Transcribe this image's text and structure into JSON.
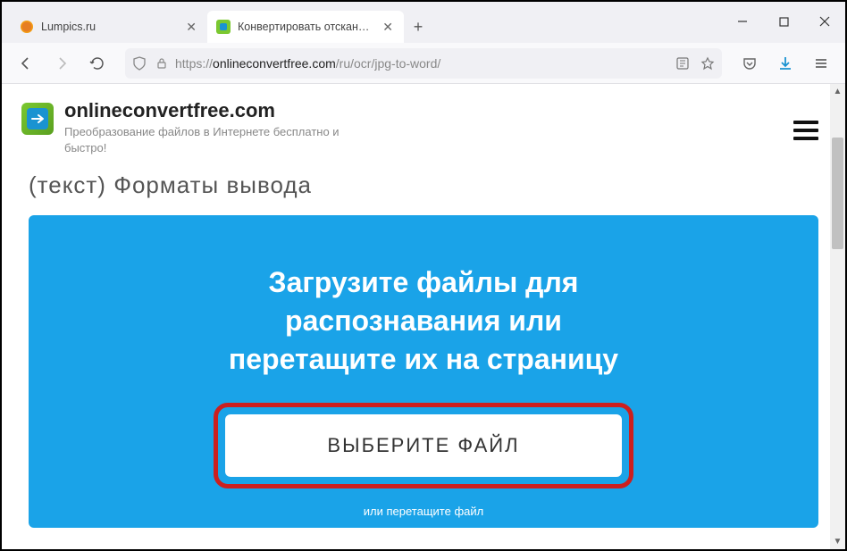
{
  "browser": {
    "tabs": [
      {
        "title": "Lumpics.ru",
        "active": false
      },
      {
        "title": "Конвертировать отсканирован",
        "active": true
      }
    ],
    "new_tab": "+",
    "address": {
      "prefix": "https://",
      "domain": "onlineconvertfree.com",
      "path": "/ru/ocr/jpg-to-word/"
    }
  },
  "site": {
    "name": "onlineconvertfree.com",
    "tagline": "Преобразование файлов в Интернете бесплатно и быстро!"
  },
  "cutoff": "(текст) Форматы вывода",
  "upload": {
    "title_l1": "Загрузите файлы для",
    "title_l2": "распознавания или",
    "title_l3": "перетащите их на страницу",
    "button": "ВЫБЕРИТЕ ФАЙЛ",
    "hint": "или перетащите файл"
  },
  "colors": {
    "accent_blue": "#1aa3e8",
    "highlight_red": "#cc1f1f",
    "logo_green": "#7bc830"
  }
}
